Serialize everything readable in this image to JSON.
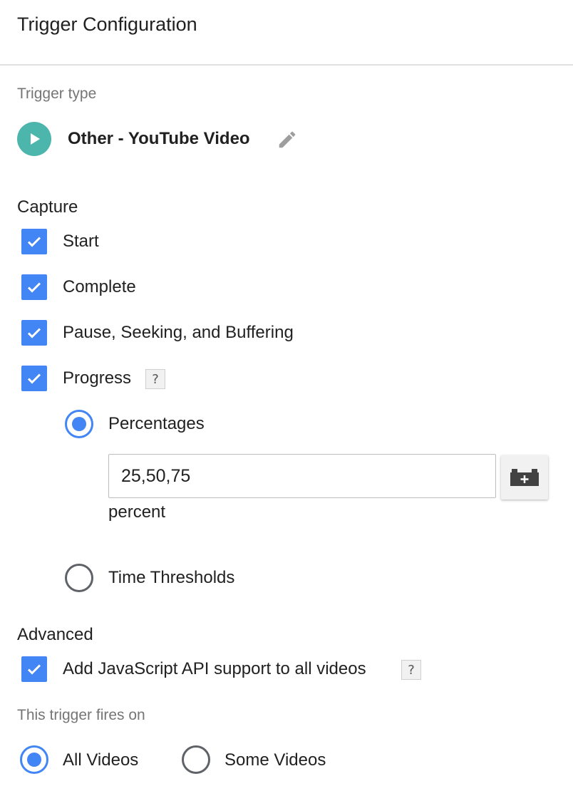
{
  "header": {
    "title": "Trigger Configuration"
  },
  "trigger_type": {
    "label": "Trigger type",
    "name": "Other - YouTube Video",
    "icon": "play-icon",
    "icon_color": "#4db6ac"
  },
  "capture": {
    "label": "Capture",
    "start": {
      "label": "Start",
      "checked": true
    },
    "complete": {
      "label": "Complete",
      "checked": true
    },
    "pause": {
      "label": "Pause, Seeking, and Buffering",
      "checked": true
    },
    "progress": {
      "label": "Progress",
      "checked": true,
      "help": "?"
    },
    "percentages": {
      "label": "Percentages",
      "selected": true,
      "value": "25,50,75",
      "unit": "percent"
    },
    "time_thresholds": {
      "label": "Time Thresholds",
      "selected": false
    }
  },
  "advanced": {
    "label": "Advanced",
    "js_api": {
      "label": "Add JavaScript API support to all videos",
      "checked": true,
      "help": "?"
    }
  },
  "fires_on": {
    "label": "This trigger fires on",
    "all_videos": {
      "label": "All Videos",
      "selected": true
    },
    "some_videos": {
      "label": "Some Videos",
      "selected": false
    }
  },
  "colors": {
    "accent": "#4285f4",
    "trigger_icon": "#4db6ac"
  }
}
